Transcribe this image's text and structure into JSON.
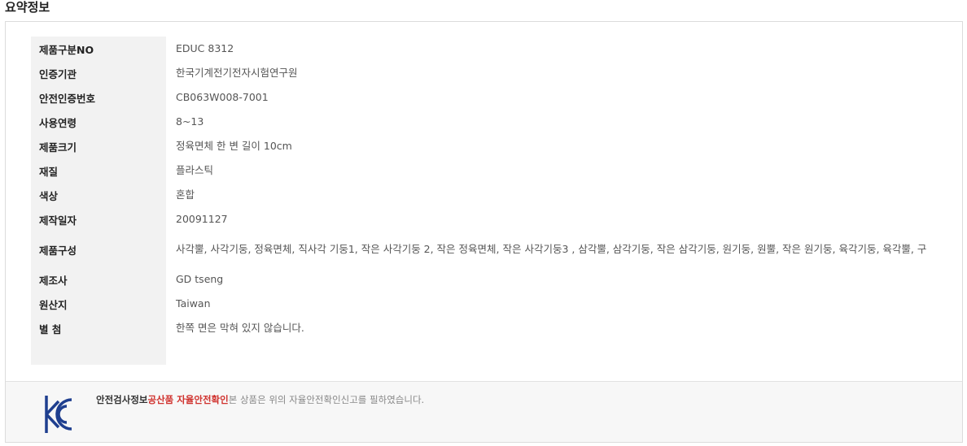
{
  "section": {
    "title": "요약정보"
  },
  "specs": [
    {
      "label": "제품구분NO",
      "value": "EDUC 8312"
    },
    {
      "label": "인증기관",
      "value": "한국기계전기전자시험연구원"
    },
    {
      "label": "안전인증번호",
      "value": "CB063W008-7001"
    },
    {
      "label": "사용연령",
      "value": "8~13"
    },
    {
      "label": "제품크기",
      "value": "정육면체 한 변 길이 10cm"
    },
    {
      "label": "재질",
      "value": "플라스틱"
    },
    {
      "label": "색상",
      "value": "혼합"
    },
    {
      "label": "제작일자",
      "value": "20091127"
    },
    {
      "label": "제품구성",
      "value": "사각뿔, 사각기둥, 정육면체, 직사각 기둥1, 작은 사각기둥 2, 작은 정육면체, 작은 사각기둥3 , 삼각뿔, 삼각기둥, 작은 삼각기둥, 원기둥, 원뿔, 작은 원기둥, 육각기둥, 육각뿔, 구"
    },
    {
      "label": "제조사",
      "value": "GD tseng"
    },
    {
      "label": "원산지",
      "value": "Taiwan"
    },
    {
      "label": "별 첨",
      "value": "한쪽 면은 막혀 있지 않습니다."
    }
  ],
  "footer": {
    "icon": "kc-certification-mark",
    "prefix": "안전검사정보",
    "highlight": "공산품 자율안전확인",
    "text": "본 상품은 위의 자율안전확인신고를 필하였습니다.",
    "accent_color": "#d0312d",
    "icon_color": "#1f3f8f"
  }
}
